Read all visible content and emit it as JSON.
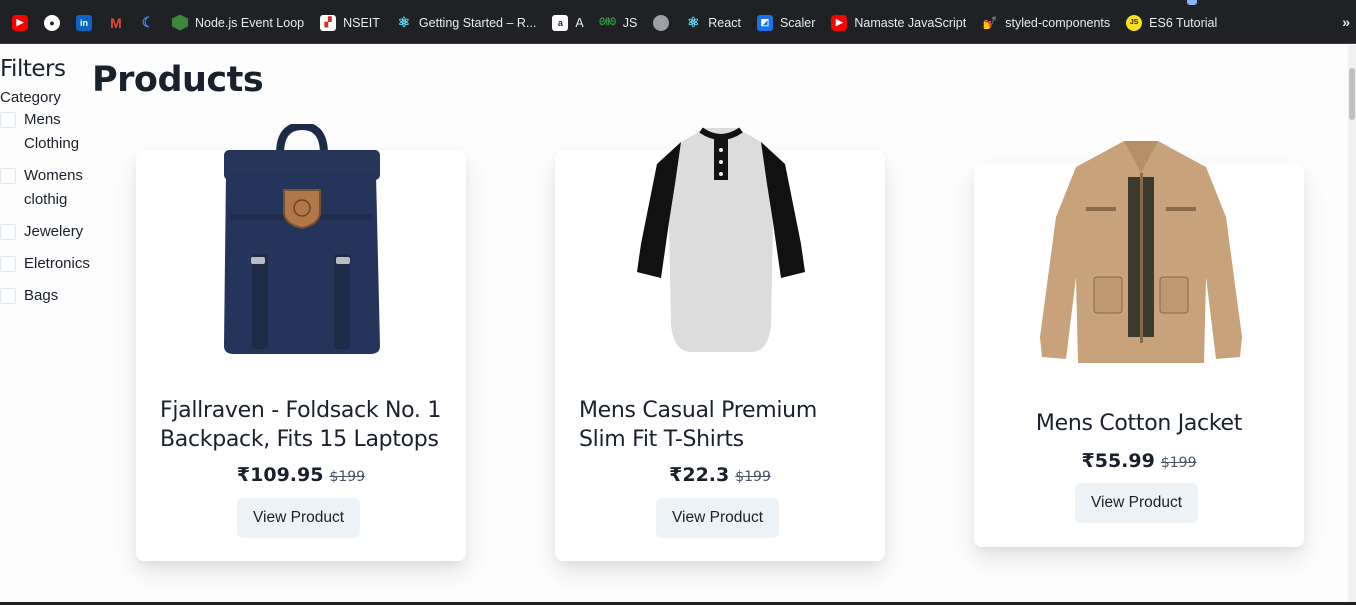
{
  "bookmarks": {
    "items": [
      {
        "icon": "youtube-icon",
        "label": "",
        "color": "#ff0000"
      },
      {
        "icon": "github-icon",
        "label": "",
        "color": "#ffffff"
      },
      {
        "icon": "linkedin-icon",
        "label": "",
        "color": "#0a66c2"
      },
      {
        "icon": "gmail-icon",
        "label": "",
        "color": "#ea4335"
      },
      {
        "icon": "crescent-icon",
        "label": "",
        "color": "#4285f4"
      },
      {
        "icon": "nodejs-icon",
        "label": "Node.js Event Loop",
        "color": "#3c873a"
      },
      {
        "icon": "nseit-icon",
        "label": "NSEIT",
        "color": "#ffffff"
      },
      {
        "icon": "react-icon",
        "label": "Getting Started – R...",
        "color": "#61dafb"
      },
      {
        "icon": "amazon-icon",
        "label": "A",
        "color": "#ffffff"
      },
      {
        "icon": "gfg-icon",
        "label": "JS",
        "color": "#2f8d46"
      },
      {
        "icon": "avatar-icon",
        "label": "",
        "color": "#9aa0a6"
      },
      {
        "icon": "react-icon",
        "label": "React",
        "color": "#61dafb"
      },
      {
        "icon": "scaler-icon",
        "label": "Scaler",
        "color": "#1a73e8"
      },
      {
        "icon": "youtube-icon",
        "label": "Namaste JavaScript",
        "color": "#ff0000"
      },
      {
        "icon": "styled-components-icon",
        "label": "styled-components",
        "color": "#db7093"
      },
      {
        "icon": "js-icon",
        "label": "ES6 Tutorial",
        "color": "#f7df1e"
      }
    ],
    "more_label": "»"
  },
  "filters": {
    "title": "Filters",
    "category_label": "Category",
    "options": [
      {
        "label_lines": [
          "Mens",
          "Clothing"
        ],
        "checked": false
      },
      {
        "label_lines": [
          "Womens",
          "clothig"
        ],
        "checked": false
      },
      {
        "label_lines": [
          "Jewelery"
        ],
        "checked": false
      },
      {
        "label_lines": [
          "Eletronics"
        ],
        "checked": false
      },
      {
        "label_lines": [
          "Bags"
        ],
        "checked": false
      }
    ]
  },
  "products_title": "Products",
  "products": [
    {
      "name": "Fjallraven - Foldsack No. 1 Backpack, Fits 15 Laptops",
      "price": "₹109.95",
      "old_price": "$199",
      "button": "View Product",
      "image": "backpack-image"
    },
    {
      "name": "Mens Casual Premium Slim Fit T-Shirts",
      "price": "₹22.3",
      "old_price": "$199",
      "button": "View Product",
      "image": "tshirt-image"
    },
    {
      "name": "Mens Cotton Jacket",
      "price": "₹55.99",
      "old_price": "$199",
      "button": "View Product",
      "image": "jacket-image"
    }
  ]
}
